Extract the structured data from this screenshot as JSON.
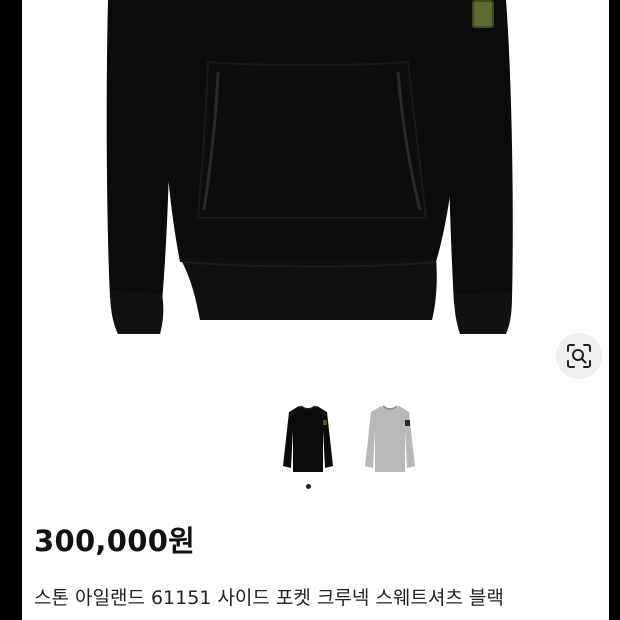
{
  "product": {
    "price": "300,000원",
    "title": "스톤 아일랜드 61151 사이드 포켓 크루넥 스웨트셔츠 블랙"
  },
  "gallery": {
    "thumbnails": [
      {
        "name": "black-sweatshirt",
        "selected": true
      },
      {
        "name": "grey-sweatshirt",
        "selected": false
      }
    ]
  },
  "icons": {
    "lens": "visual-search-lens-icon"
  },
  "colors": {
    "garment_black": "#0b0b0b",
    "garment_grey": "#b8b8b8",
    "badge_green": "#3f4a23",
    "lens_bg": "#efefef"
  }
}
